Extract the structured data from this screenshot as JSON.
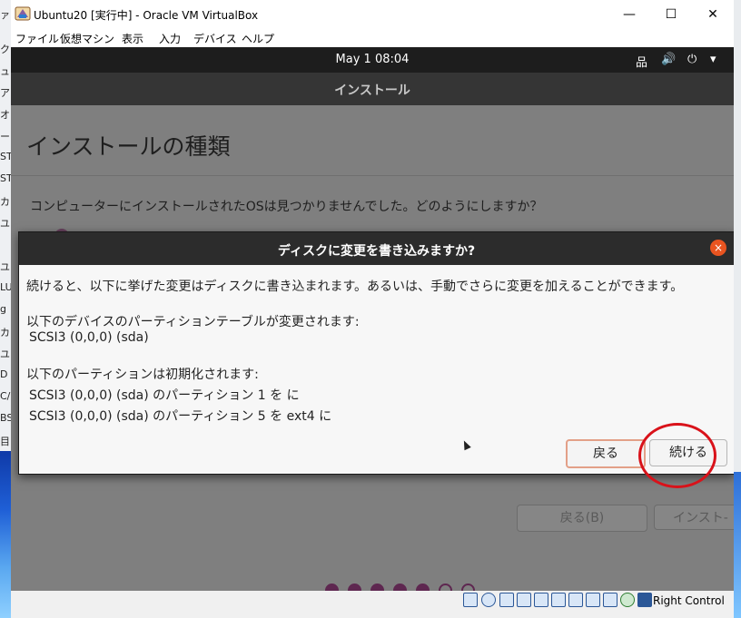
{
  "window": {
    "title": "Ubuntu20 [実行中] - Oracle VM VirtualBox",
    "menu": [
      "ファイル",
      "仮想マシン",
      "表示",
      "入力",
      "デバイス",
      "ヘルプ"
    ],
    "min_glyph": "—",
    "max_glyph": "☐",
    "close_glyph": "✕"
  },
  "desktop_fragments": [
    "ァ",
    "ク",
    "ュ",
    "ア",
    "オ",
    "ー",
    "ST",
    "ST",
    "カ",
    "ユ",
    "ユ",
    "LU",
    "g",
    "カ",
    "ユ",
    "D",
    "C/",
    "BS",
    "目"
  ],
  "ubuntu": {
    "clock": "May 1  08:04",
    "tray": {
      "network_glyph": "品",
      "volume_glyph": "🔊",
      "power_glyph": "⏻",
      "menu_glyph": "▾"
    },
    "header_title": "インストール",
    "page_title": "インストールの種類",
    "question": "コンピューターにインストールされたOSは見つかりませんでした。どのようにしますか？",
    "bg_back_button": "戻る(B)",
    "bg_install_button": "インスト-",
    "progress_dots": {
      "filled": 5,
      "empty": 2
    }
  },
  "dialog": {
    "title": "ディスクに変更を書き込みますか?",
    "close_glyph": "×",
    "intro": "続けると、以下に挙げた変更はディスクに書き込まれます。あるいは、手動でさらに変更を加えることができます。",
    "table_heading": "以下のデバイスのパーティションテーブルが変更されます:",
    "table_device": "SCSI3 (0,0,0) (sda)",
    "format_heading": "以下のパーティションは初期化されます:",
    "partition_1": "SCSI3 (0,0,0) (sda) のパーティション 1 を  に",
    "partition_5": "SCSI3 (0,0,0) (sda) のパーティション 5 を ext4 に",
    "back_button": "戻る",
    "continue_button": "続ける"
  },
  "statusbar": {
    "icons": [
      "hdd-icon",
      "optical-icon",
      "audio-icon",
      "network-icon",
      "usb-icon",
      "shared-folder-icon",
      "display-icon",
      "recording-icon",
      "cpu-icon",
      "mouse-integration-icon",
      "keyboard-icon"
    ],
    "host_key": "Right Control"
  },
  "colors": {
    "accent": "#e95420",
    "aubergine": "#5e2750",
    "annotation": "#d9121a"
  }
}
